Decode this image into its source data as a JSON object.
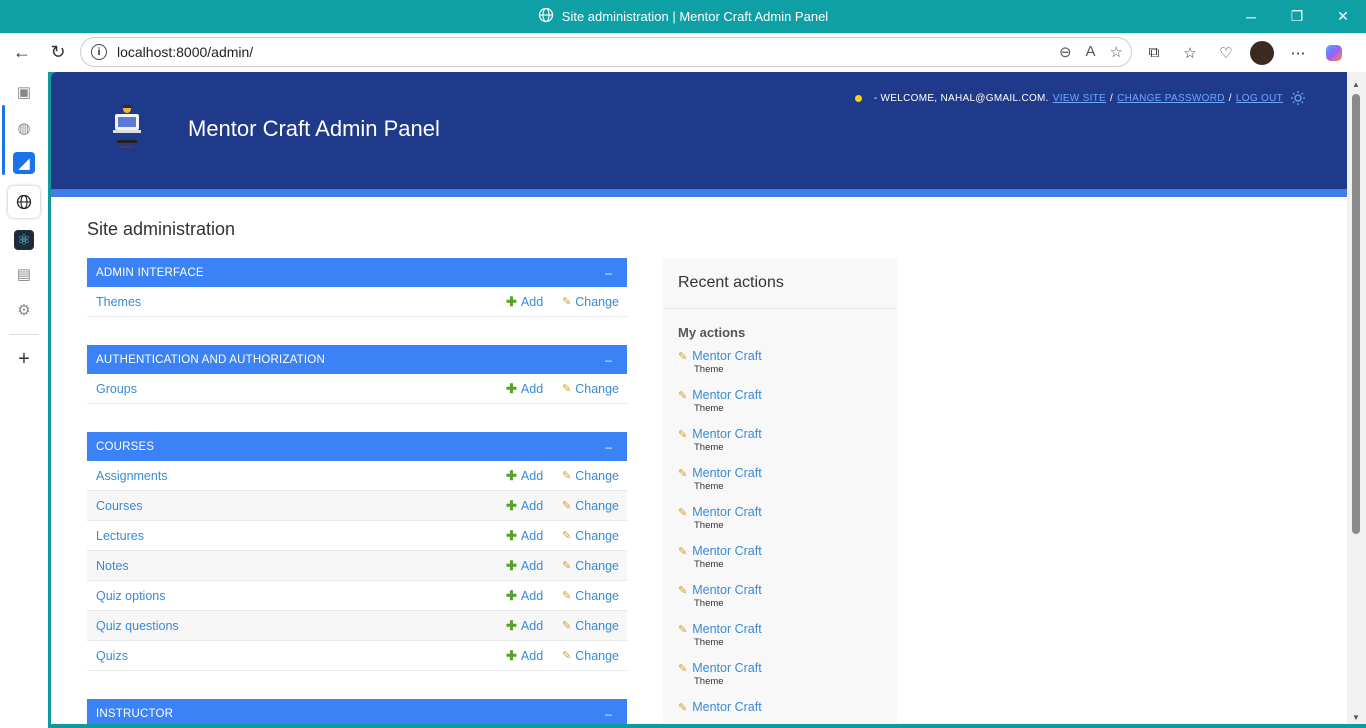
{
  "window": {
    "title": "Site administration | Mentor Craft Admin Panel"
  },
  "browser": {
    "url": "localhost:8000/admin/"
  },
  "header": {
    "brand": "Mentor Craft Admin Panel",
    "welcome": "- WELCOME, NAHAL@GMAIL.COM.",
    "view_site": "VIEW SITE",
    "change_password": "CHANGE PASSWORD",
    "log_out": "LOG OUT",
    "sep": "/"
  },
  "content": {
    "title": "Site administration"
  },
  "labels": {
    "add": "Add",
    "change": "Change",
    "collapse": "–"
  },
  "modules": [
    {
      "name": "ADMIN INTERFACE",
      "rows": [
        "Themes"
      ]
    },
    {
      "name": "AUTHENTICATION AND AUTHORIZATION",
      "rows": [
        "Groups"
      ]
    },
    {
      "name": "COURSES",
      "rows": [
        "Assignments",
        "Courses",
        "Lectures",
        "Notes",
        "Quiz options",
        "Quiz questions",
        "Quizs"
      ]
    },
    {
      "name": "INSTRUCTOR",
      "rows": []
    }
  ],
  "recent": {
    "title": "Recent actions",
    "my_actions": "My actions",
    "items": [
      {
        "name": "Mentor Craft",
        "type": "Theme"
      },
      {
        "name": "Mentor Craft",
        "type": "Theme"
      },
      {
        "name": "Mentor Craft",
        "type": "Theme"
      },
      {
        "name": "Mentor Craft",
        "type": "Theme"
      },
      {
        "name": "Mentor Craft",
        "type": "Theme"
      },
      {
        "name": "Mentor Craft",
        "type": "Theme"
      },
      {
        "name": "Mentor Craft",
        "type": "Theme"
      },
      {
        "name": "Mentor Craft",
        "type": "Theme"
      },
      {
        "name": "Mentor Craft",
        "type": "Theme"
      },
      {
        "name": "Mentor Craft",
        "type": ""
      }
    ]
  },
  "colors": {
    "header_bg": "#1f3a8a",
    "module_head": "#3b82f6",
    "link": "#3a8ad6",
    "titlebar": "#0fa0a6"
  }
}
